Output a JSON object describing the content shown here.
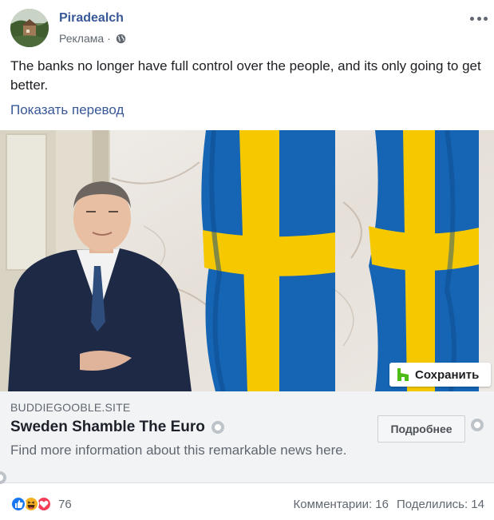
{
  "post": {
    "page_name": "Piradealch",
    "sponsored_label": "Реклама",
    "meta_separator": "·",
    "audience_icon": "globe-icon",
    "more_icon": "more-options-icon",
    "text": "The banks no longer have full control over the people, and its only going to get better.",
    "translate_label": "Показать перевод"
  },
  "media": {
    "save_label": "Сохранить",
    "save_icon": "houzz-h-icon"
  },
  "link": {
    "domain": "BUDDIEGOOBLE.SITE",
    "headline": "Sweden Shamble The Euro",
    "description": "Find more information about this remarkable news here.",
    "cta_label": "Подробнее"
  },
  "footer": {
    "reaction_icons": [
      "like-icon",
      "haha-icon",
      "love-icon"
    ],
    "reaction_count": "76",
    "comments_label": "Комментарии: 16",
    "shares_label": "Поделились: 14"
  },
  "colors": {
    "link_blue": "#385898",
    "meta_gray": "#606770",
    "like_blue": "#1877f2",
    "love_red": "#f33e58",
    "haha_yellow": "#f7b125",
    "flag_blue": "#1565b4",
    "flag_yellow": "#f5c800"
  }
}
